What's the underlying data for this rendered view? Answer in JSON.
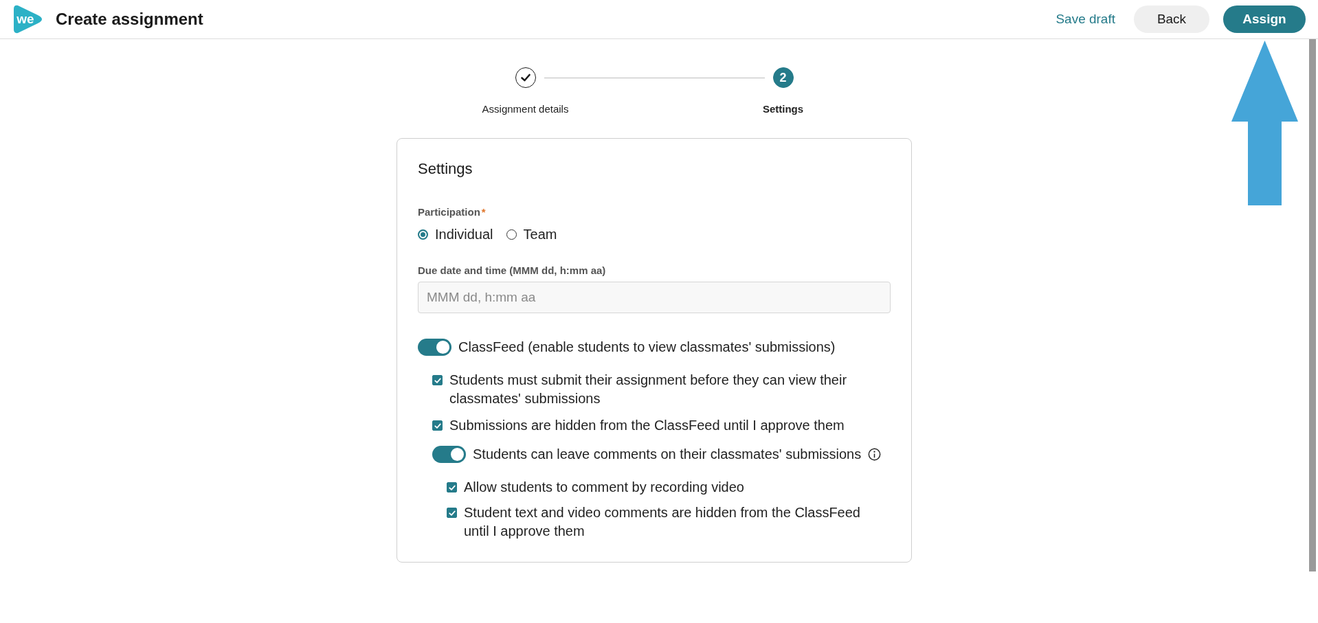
{
  "header": {
    "logo": "we",
    "title": "Create assignment",
    "actions": [
      {
        "label": "Save draft",
        "kind": "link"
      },
      {
        "label": "Back",
        "kind": "secondary"
      },
      {
        "label": "Assign",
        "kind": "primary"
      }
    ]
  },
  "stepper": {
    "steps": [
      {
        "label": "Assignment details",
        "completed": true,
        "selected": false
      },
      {
        "label": "Settings",
        "number": "2",
        "completed": false,
        "selected": true
      }
    ]
  },
  "settings": {
    "title": "Settings",
    "participation": {
      "label": "Participation",
      "required_mark": "*",
      "options": [
        {
          "label": "Individual",
          "selected": true
        },
        {
          "label": "Team",
          "selected": false
        }
      ]
    },
    "due_date": {
      "label": "Due date and time (MMM dd, h:mm aa)",
      "placeholder": "MMM dd, h:mm aa"
    },
    "options": [
      {
        "kind": "toggle",
        "label": "ClassFeed (enable students to view classmates' submissions)",
        "on": true,
        "children": [
          {
            "kind": "checkbox",
            "label": "Students must submit their assignment before they can view their classmates' submissions",
            "checked": true
          },
          {
            "kind": "checkbox",
            "label": "Submissions are hidden from the ClassFeed until I approve them",
            "checked": true
          },
          {
            "kind": "toggle",
            "label": "Students can leave comments on their classmates' submissions",
            "on": true,
            "info": true,
            "children": [
              {
                "kind": "checkbox",
                "label": "Allow students to comment by recording video",
                "checked": true
              },
              {
                "kind": "checkbox",
                "label": "Student text and video comments are hidden from the ClassFeed until I approve them",
                "checked": true
              }
            ]
          }
        ]
      }
    ]
  }
}
